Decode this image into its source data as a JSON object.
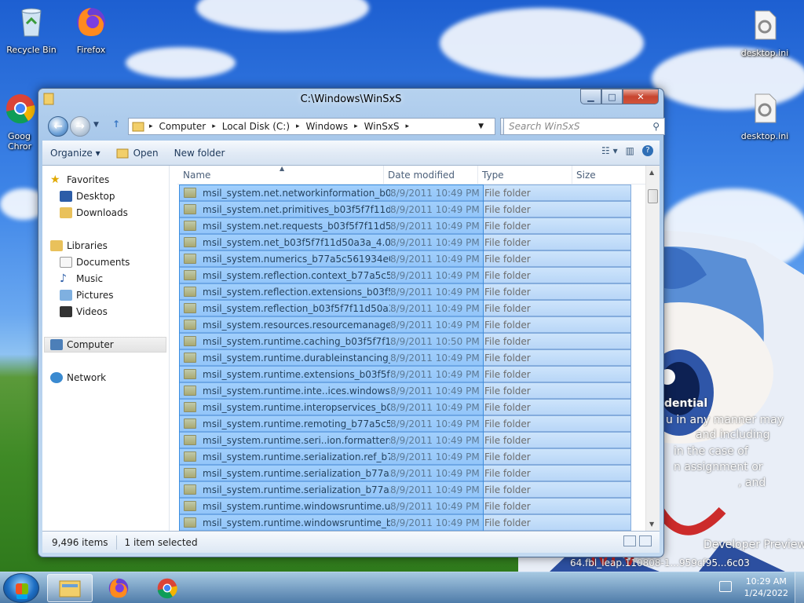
{
  "desktop": {
    "icons": {
      "recycle_bin": "Recycle Bin",
      "firefox": "Firefox",
      "chrome_partial": "Goog\nChror",
      "desktop_ini_1": "desktop.ini",
      "desktop_ini_2": "desktop.ini"
    },
    "overlay": {
      "line1": "dential",
      "line2": "u in any manner may",
      "line3": "and including",
      "line4": "in the case of",
      "line5": "n assignment or",
      "line6": ", and",
      "line7": "Developer Preview",
      "line8": "64.fbl_leap.110808-1...959cf95...6c03"
    }
  },
  "window": {
    "title": "C:\\Windows\\WinSxS",
    "breadcrumb": [
      "Computer",
      "Local Disk (C:)",
      "Windows",
      "WinSxS"
    ],
    "search_placeholder": "Search WinSxS",
    "toolbar": {
      "organize": "Organize ▾",
      "open": "Open",
      "new_folder": "New folder"
    },
    "nav": {
      "favorites": "Favorites",
      "desktop": "Desktop",
      "downloads": "Downloads",
      "libraries": "Libraries",
      "documents": "Documents",
      "music": "Music",
      "pictures": "Pictures",
      "videos": "Videos",
      "computer": "Computer",
      "network": "Network"
    },
    "columns": {
      "name": "Name",
      "date": "Date modified",
      "type": "Type",
      "size": "Size"
    },
    "rows": [
      {
        "name": "msil_system.net.networkinformation_b03...",
        "date": "8/9/2011 10:49 PM",
        "type": "File folder"
      },
      {
        "name": "msil_system.net.primitives_b03f5f7f11d5...",
        "date": "8/9/2011 10:49 PM",
        "type": "File folder"
      },
      {
        "name": "msil_system.net.requests_b03f5f7f11d50a...",
        "date": "8/9/2011 10:49 PM",
        "type": "File folder"
      },
      {
        "name": "msil_system.net_b03f5f7f11d50a3a_4.0.80...",
        "date": "8/9/2011 10:49 PM",
        "type": "File folder"
      },
      {
        "name": "msil_system.numerics_b77a5c561934e08...",
        "date": "8/9/2011 10:49 PM",
        "type": "File folder"
      },
      {
        "name": "msil_system.reflection.context_b77a5c56...",
        "date": "8/9/2011 10:49 PM",
        "type": "File folder"
      },
      {
        "name": "msil_system.reflection.extensions_b03f5f...",
        "date": "8/9/2011 10:49 PM",
        "type": "File folder"
      },
      {
        "name": "msil_system.reflection_b03f5f7f11d50a3a...",
        "date": "8/9/2011 10:49 PM",
        "type": "File folder"
      },
      {
        "name": "msil_system.resources.resourcemanager_...",
        "date": "8/9/2011 10:49 PM",
        "type": "File folder"
      },
      {
        "name": "msil_system.runtime.caching_b03f5f7f11...",
        "date": "8/9/2011 10:50 PM",
        "type": "File folder"
      },
      {
        "name": "msil_system.runtime.durableinstancing_...",
        "date": "8/9/2011 10:49 PM",
        "type": "File folder"
      },
      {
        "name": "msil_system.runtime.extensions_b03f5f7f...",
        "date": "8/9/2011 10:49 PM",
        "type": "File folder"
      },
      {
        "name": "msil_system.runtime.inte..ices.windowsr...",
        "date": "8/9/2011 10:49 PM",
        "type": "File folder"
      },
      {
        "name": "msil_system.runtime.interopservices_b03...",
        "date": "8/9/2011 10:49 PM",
        "type": "File folder"
      },
      {
        "name": "msil_system.runtime.remoting_b77a5c56...",
        "date": "8/9/2011 10:49 PM",
        "type": "File folder"
      },
      {
        "name": "msil_system.runtime.seri..ion.formatters....",
        "date": "8/9/2011 10:49 PM",
        "type": "File folder"
      },
      {
        "name": "msil_system.runtime.serialization.ref_b77...",
        "date": "8/9/2011 10:49 PM",
        "type": "File folder"
      },
      {
        "name": "msil_system.runtime.serialization_b77a5c...",
        "date": "8/9/2011 10:49 PM",
        "type": "File folder"
      },
      {
        "name": "msil_system.runtime.serialization_b77a5c...",
        "date": "8/9/2011 10:49 PM",
        "type": "File folder"
      },
      {
        "name": "msil_system.runtime.windowsruntime.ui....",
        "date": "8/9/2011 10:49 PM",
        "type": "File folder"
      },
      {
        "name": "msil_system.runtime.windowsruntime_b...",
        "date": "8/9/2011 10:49 PM",
        "type": "File folder"
      }
    ],
    "status": {
      "items": "9,496 items",
      "selected": "1 item selected"
    }
  },
  "taskbar": {
    "time": "10:29 AM",
    "date": "1/24/2022"
  }
}
